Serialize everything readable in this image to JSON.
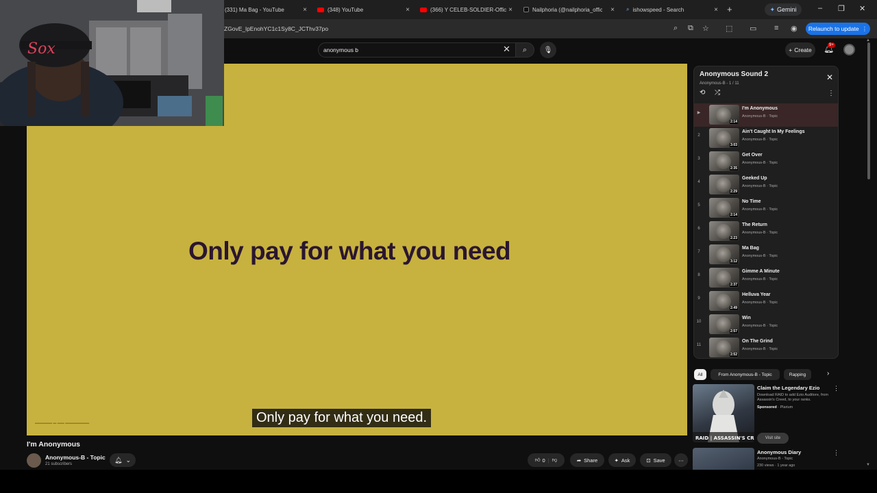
{
  "browser": {
    "tabs": [
      {
        "title": "(331) Ma Bag - YouTube",
        "favicon": "none"
      },
      {
        "title": "(348) YouTube",
        "favicon": "youtube-icon"
      },
      {
        "title": "(366) Y CELEB-SOLDIER-Offic",
        "favicon": "youtube-icon"
      },
      {
        "title": "Nailphoria (@nailphoria_offic",
        "favicon": "tiktok-icon"
      },
      {
        "title": "ishowspeed - Search",
        "favicon": "search-icon"
      }
    ],
    "close_glyph": "×",
    "new_tab_glyph": "+",
    "gemini_label": "Gemini",
    "url": "ZGovE_lpEnohYC1c1Sy8C_JCThv37po",
    "relaunch_label": "Relaunch to update"
  },
  "youtube": {
    "search_value": "anonymous b",
    "create_label": "Create",
    "notification_count": "9+"
  },
  "video": {
    "ad_headline": "Only pay for what you need",
    "caption": "Only pay for what you need.",
    "title": "I'm Anonymous",
    "channel": "Anonymous-B - Topic",
    "subscribers": "21 subscribers",
    "like_count": "0",
    "share_label": "Share",
    "ask_label": "Ask",
    "save_label": "Save"
  },
  "playlist": {
    "title": "Anonymous Sound 2",
    "subtitle": "Anonymous-B - 1 / 11",
    "tracks": [
      {
        "index": "▶",
        "title": "I'm Anonymous",
        "artist": "Anonymous-B · Topic",
        "duration": "2:14"
      },
      {
        "index": "2",
        "title": "Ain't Caught In My Feelings",
        "artist": "Anonymous-B · Topic",
        "duration": "3:03"
      },
      {
        "index": "3",
        "title": "Get Over",
        "artist": "Anonymous-B · Topic",
        "duration": "2:35"
      },
      {
        "index": "4",
        "title": "Geeked Up",
        "artist": "Anonymous-B · Topic",
        "duration": "2:29"
      },
      {
        "index": "5",
        "title": "No Time",
        "artist": "Anonymous-B · Topic",
        "duration": "2:14"
      },
      {
        "index": "6",
        "title": "The Return",
        "artist": "Anonymous-B · Topic",
        "duration": "2:23"
      },
      {
        "index": "7",
        "title": "Ma Bag",
        "artist": "Anonymous-B · Topic",
        "duration": "3:12"
      },
      {
        "index": "8",
        "title": "Gimme A Minute",
        "artist": "Anonymous-B · Topic",
        "duration": "2:37"
      },
      {
        "index": "9",
        "title": "Helluva Year",
        "artist": "Anonymous-B · Topic",
        "duration": "2:49"
      },
      {
        "index": "10",
        "title": "Win",
        "artist": "Anonymous-B · Topic",
        "duration": "2:57"
      },
      {
        "index": "11",
        "title": "On The Grind",
        "artist": "Anonymous-B · Topic",
        "duration": "2:52"
      }
    ]
  },
  "chips": [
    "All",
    "From Anonymous-B - Topic",
    "Rapping"
  ],
  "sidebar_ad": {
    "title": "Claim the Legendary Ezio",
    "description": "Download RAID to add Ezio Auditore, from Assassin's Creed, to your ranks.",
    "sponsored": "Sponsored",
    "advertiser": "Plarium",
    "visit_label": "Visit site",
    "thumb_text": "RAID | ASSASSIN'S CREED"
  },
  "recommended": {
    "title": "Anonymous Diary",
    "channel": "Anonymous-B - Topic",
    "meta": "230 views · 1 year ago"
  },
  "colors": {
    "video_bg": "#c7b23f",
    "headline": "#2b1630",
    "accent_blue": "#1a73e8",
    "active_row": "#3a2626"
  }
}
